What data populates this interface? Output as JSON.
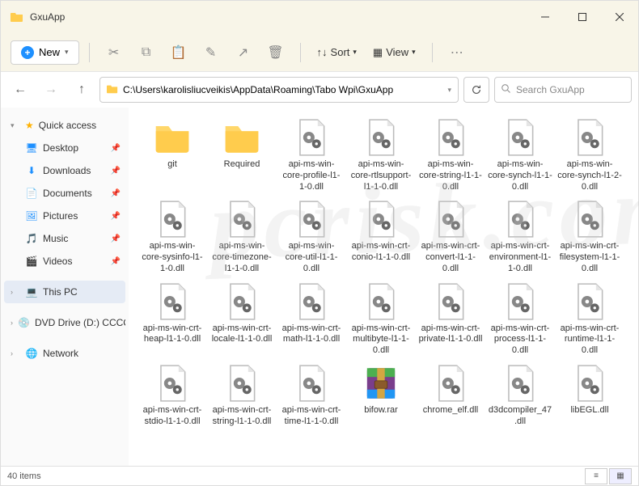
{
  "window": {
    "title": "GxuApp"
  },
  "toolbar": {
    "new_label": "New",
    "sort_label": "Sort",
    "view_label": "View"
  },
  "address": {
    "path": "C:\\Users\\karolisliucveikis\\AppData\\Roaming\\Tabo Wpi\\GxuApp",
    "search_placeholder": "Search GxuApp"
  },
  "sidebar": {
    "quick_label": "Quick access",
    "items": [
      {
        "label": "Desktop"
      },
      {
        "label": "Downloads"
      },
      {
        "label": "Documents"
      },
      {
        "label": "Pictures"
      },
      {
        "label": "Music"
      },
      {
        "label": "Videos"
      }
    ],
    "thispc_label": "This PC",
    "dvd_label": "DVD Drive (D:) CCCC",
    "network_label": "Network"
  },
  "items": [
    {
      "name": "git",
      "type": "folder"
    },
    {
      "name": "Required",
      "type": "folder"
    },
    {
      "name": "api-ms-win-core-profile-l1-1-0.dll",
      "type": "dll"
    },
    {
      "name": "api-ms-win-core-rtlsupport-l1-1-0.dll",
      "type": "dll"
    },
    {
      "name": "api-ms-win-core-string-l1-1-0.dll",
      "type": "dll"
    },
    {
      "name": "api-ms-win-core-synch-l1-1-0.dll",
      "type": "dll"
    },
    {
      "name": "api-ms-win-core-synch-l1-2-0.dll",
      "type": "dll"
    },
    {
      "name": "api-ms-win-core-sysinfo-l1-1-0.dll",
      "type": "dll"
    },
    {
      "name": "api-ms-win-core-timezone-l1-1-0.dll",
      "type": "dll"
    },
    {
      "name": "api-ms-win-core-util-l1-1-0.dll",
      "type": "dll"
    },
    {
      "name": "api-ms-win-crt-conio-l1-1-0.dll",
      "type": "dll"
    },
    {
      "name": "api-ms-win-crt-convert-l1-1-0.dll",
      "type": "dll"
    },
    {
      "name": "api-ms-win-crt-environment-l1-1-0.dll",
      "type": "dll"
    },
    {
      "name": "api-ms-win-crt-filesystem-l1-1-0.dll",
      "type": "dll"
    },
    {
      "name": "api-ms-win-crt-heap-l1-1-0.dll",
      "type": "dll"
    },
    {
      "name": "api-ms-win-crt-locale-l1-1-0.dll",
      "type": "dll"
    },
    {
      "name": "api-ms-win-crt-math-l1-1-0.dll",
      "type": "dll"
    },
    {
      "name": "api-ms-win-crt-multibyte-l1-1-0.dll",
      "type": "dll"
    },
    {
      "name": "api-ms-win-crt-private-l1-1-0.dll",
      "type": "dll"
    },
    {
      "name": "api-ms-win-crt-process-l1-1-0.dll",
      "type": "dll"
    },
    {
      "name": "api-ms-win-crt-runtime-l1-1-0.dll",
      "type": "dll"
    },
    {
      "name": "api-ms-win-crt-stdio-l1-1-0.dll",
      "type": "dll"
    },
    {
      "name": "api-ms-win-crt-string-l1-1-0.dll",
      "type": "dll"
    },
    {
      "name": "api-ms-win-crt-time-l1-1-0.dll",
      "type": "dll"
    },
    {
      "name": "bifow.rar",
      "type": "rar"
    },
    {
      "name": "chrome_elf.dll",
      "type": "dll"
    },
    {
      "name": "d3dcompiler_47.dll",
      "type": "dll"
    },
    {
      "name": "libEGL.dll",
      "type": "dll"
    }
  ],
  "status": {
    "count_label": "40 items"
  }
}
